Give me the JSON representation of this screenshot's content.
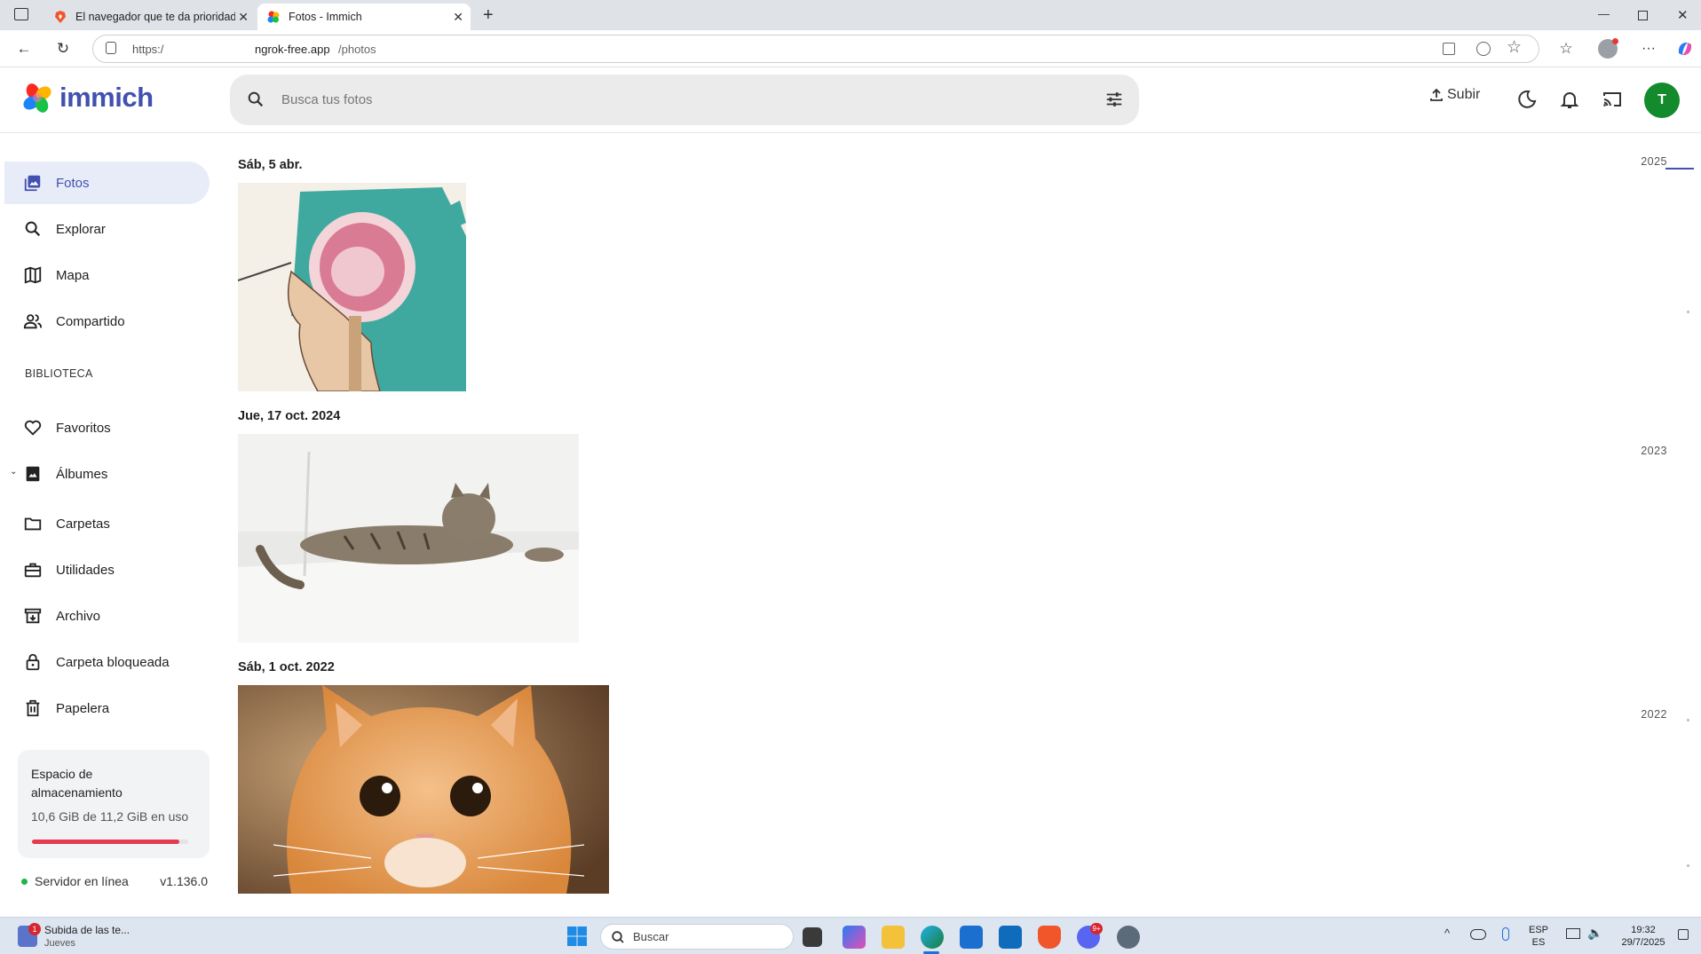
{
  "browser": {
    "tabs": [
      {
        "title": "El navegador que te da prioridad"
      },
      {
        "title": "Fotos - Immich"
      }
    ],
    "url_prefix": "https:/",
    "url_host": "ngrok-free.app",
    "url_path": "/photos"
  },
  "app": {
    "name": "immich",
    "search_placeholder": "Busca tus fotos",
    "upload_label": "Subir",
    "avatar_initial": "T",
    "brand_color": "#4250af"
  },
  "sidebar": {
    "items": [
      {
        "label": "Fotos",
        "icon": "photos-icon",
        "active": true
      },
      {
        "label": "Explorar",
        "icon": "search-icon"
      },
      {
        "label": "Mapa",
        "icon": "map-icon"
      },
      {
        "label": "Compartido",
        "icon": "people-icon"
      }
    ],
    "section_title": "BIBLIOTECA",
    "library": [
      {
        "label": "Favoritos",
        "icon": "heart-icon"
      },
      {
        "label": "Álbumes",
        "icon": "album-icon"
      },
      {
        "label": "Carpetas",
        "icon": "folder-icon"
      },
      {
        "label": "Utilidades",
        "icon": "toolbox-icon"
      },
      {
        "label": "Archivo",
        "icon": "archive-icon"
      },
      {
        "label": "Carpeta bloqueada",
        "icon": "lock-icon"
      },
      {
        "label": "Papelera",
        "icon": "trash-icon"
      }
    ],
    "storage": {
      "title": "Espacio de almacenamiento",
      "usage": "10,6 GiB de 11,2 GiB en uso",
      "used_fraction": 0.946
    },
    "server_status": "Servidor en línea",
    "version": "v1.136.0"
  },
  "timeline": {
    "groups": [
      {
        "date": "Sáb, 5 abr.",
        "photo": "brain-illustration"
      },
      {
        "date": "Jue, 17 oct. 2024",
        "photo": "tabby-cat-lying"
      },
      {
        "date": "Sáb, 1 oct. 2022",
        "photo": "orange-cat-closeup"
      }
    ],
    "years": [
      "2025",
      "2023",
      "2022"
    ]
  },
  "taskbar": {
    "notification_title": "Subida de las te...",
    "notification_sub": "Jueves",
    "notification_count": "1",
    "search_label": "Buscar",
    "lang_top": "ESP",
    "lang_bottom": "ES",
    "time": "19:32",
    "date": "29/7/2025",
    "badge": "9+"
  }
}
